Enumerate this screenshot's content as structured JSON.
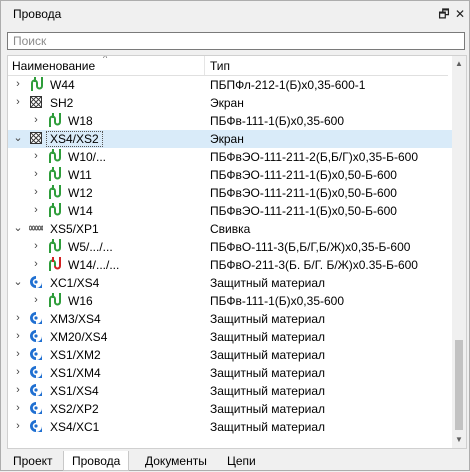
{
  "panel": {
    "title": "Провода",
    "pin_glyph": "🗗",
    "close_glyph": "✕",
    "search_placeholder": "Поиск"
  },
  "columns": {
    "name": "Наименование",
    "type": "Тип"
  },
  "rows": [
    {
      "level": 0,
      "exp": "›",
      "icon": "wire-green-icon",
      "name": "W44",
      "type": "ПБПФл-212-1(Б)x0,35-600-1"
    },
    {
      "level": 0,
      "exp": "›",
      "icon": "screen-icon",
      "name": "SH2",
      "type": "Экран"
    },
    {
      "level": 1,
      "exp": "›",
      "icon": "wire-green-icon",
      "name": "W18",
      "type": "ПБФв-111-1(Б)x0,35-600"
    },
    {
      "level": 0,
      "exp": "⌄",
      "icon": "screen-icon",
      "name": "XS4/XS2",
      "type": "Экран",
      "selected": true
    },
    {
      "level": 1,
      "exp": "›",
      "icon": "wire-green-icon",
      "name": "W10/...",
      "type": "ПБФвЭО-111-211-2(Б,Б/Г)x0,35-Б-600"
    },
    {
      "level": 1,
      "exp": "›",
      "icon": "wire-green-icon",
      "name": "W11",
      "type": "ПБФвЭО-111-211-1(Б)x0,50-Б-600"
    },
    {
      "level": 1,
      "exp": "›",
      "icon": "wire-green-icon",
      "name": "W12",
      "type": "ПБФвЭО-111-211-1(Б)x0,50-Б-600"
    },
    {
      "level": 1,
      "exp": "›",
      "icon": "wire-green-icon",
      "name": "W14",
      "type": "ПБФвЭО-111-211-1(Б)x0,50-Б-600"
    },
    {
      "level": 0,
      "exp": "⌄",
      "icon": "twist-icon",
      "name": "XS5/XP1",
      "type": "Свивка"
    },
    {
      "level": 1,
      "exp": "›",
      "icon": "wire-green-icon",
      "name": "W5/.../...",
      "type": "ПБФвО-111-3(Б,Б/Г,Б/Ж)x0,35-Б-600"
    },
    {
      "level": 1,
      "exp": "›",
      "icon": "wire-red-icon",
      "name": "W14/.../...",
      "type": "ПБФвО-211-3(Б. Б/Г. Б/Ж)x0.35-Б-600"
    },
    {
      "level": 0,
      "exp": "⌄",
      "icon": "protect-icon",
      "name": "XC1/XS4",
      "type": "Защитный материал"
    },
    {
      "level": 1,
      "exp": "›",
      "icon": "wire-green-icon",
      "name": "W16",
      "type": "ПБФв-111-1(Б)x0,35-600"
    },
    {
      "level": 0,
      "exp": "›",
      "icon": "protect-icon",
      "name": "XM3/XS4",
      "type": "Защитный материал"
    },
    {
      "level": 0,
      "exp": "›",
      "icon": "protect-icon",
      "name": "XM20/XS4",
      "type": "Защитный материал"
    },
    {
      "level": 0,
      "exp": "›",
      "icon": "protect-icon",
      "name": "XS1/XM2",
      "type": "Защитный материал"
    },
    {
      "level": 0,
      "exp": "›",
      "icon": "protect-icon",
      "name": "XS1/XM4",
      "type": "Защитный материал"
    },
    {
      "level": 0,
      "exp": "›",
      "icon": "protect-icon",
      "name": "XS1/XS4",
      "type": "Защитный материал"
    },
    {
      "level": 0,
      "exp": "›",
      "icon": "protect-icon",
      "name": "XS2/XP2",
      "type": "Защитный материал"
    },
    {
      "level": 0,
      "exp": "›",
      "icon": "protect-icon",
      "name": "XS4/XC1",
      "type": "Защитный материал"
    }
  ],
  "tabs": [
    {
      "label": "Проект",
      "active": false
    },
    {
      "label": "Провода",
      "active": true
    },
    {
      "label": "Документы",
      "active": false
    },
    {
      "label": "Цепи",
      "active": false
    }
  ],
  "colors": {
    "wire_green": "#2e9d3a",
    "wire_red": "#d32020",
    "protect_blue": "#1f6fd1",
    "selection": "#d9ebf9"
  }
}
